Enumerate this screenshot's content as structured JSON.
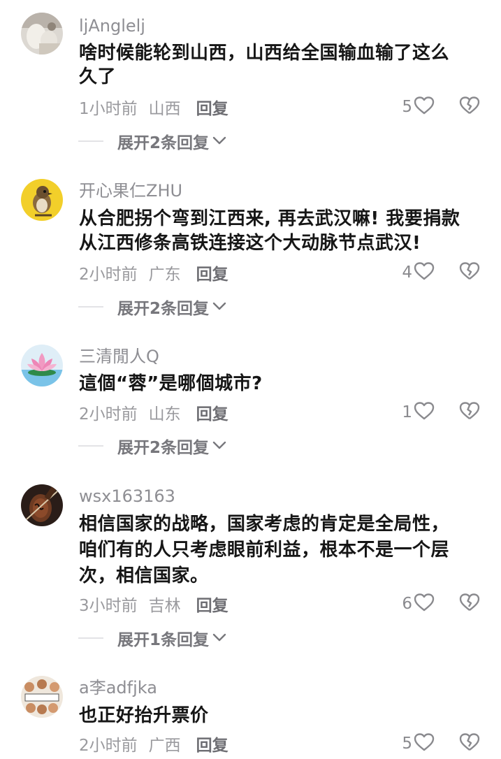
{
  "comments": [
    {
      "username": "ljAnglelj",
      "lines": [
        "啥时候能轮到山西，山西给全国输血输了这么",
        "久了"
      ],
      "time": "1小时前",
      "location": "山西",
      "reply_label": "回复",
      "likes": "5",
      "expand_label": "展开2条回复",
      "avatar_icon": "photo-avatar-icon"
    },
    {
      "username": "开心果仁ZHU",
      "lines": [
        "从合肥拐个弯到江西来, 再去武汉嘛! 我要捐款",
        "从江西修条高铁连接这个大动脉节点武汉!"
      ],
      "time": "2小时前",
      "location": "广东",
      "reply_label": "回复",
      "likes": "4",
      "expand_label": "展开2条回复",
      "avatar_icon": "sparrow-avatar-icon"
    },
    {
      "username": "三清閒人Q",
      "lines": [
        "這個“蓉”是哪個城市?"
      ],
      "time": "2小时前",
      "location": "山东",
      "reply_label": "回复",
      "likes": "1",
      "expand_label": "展开2条回复",
      "avatar_icon": "lotus-avatar-icon"
    },
    {
      "username": "wsx163163",
      "lines": [
        "相信国家的战略，国家考虑的肯定是全局性，",
        "咱们有的人只考虑眼前利益，根本不是一个层",
        "次，相信国家。"
      ],
      "time": "3小时前",
      "location": "吉林",
      "reply_label": "回复",
      "likes": "6",
      "expand_label": "展开1条回复",
      "avatar_icon": "violin-avatar-icon"
    },
    {
      "username": "a李adfjka",
      "lines": [
        "也正好抬升票价"
      ],
      "time": "2小时前",
      "location": "广西",
      "reply_label": "回复",
      "likes": "5",
      "expand_label": "",
      "avatar_icon": "group-photo-avatar-icon"
    }
  ],
  "colors": {
    "username": "#8e8e93",
    "text": "#161616",
    "meta": "#9a9a9e",
    "icon": "#8a8a8e"
  }
}
